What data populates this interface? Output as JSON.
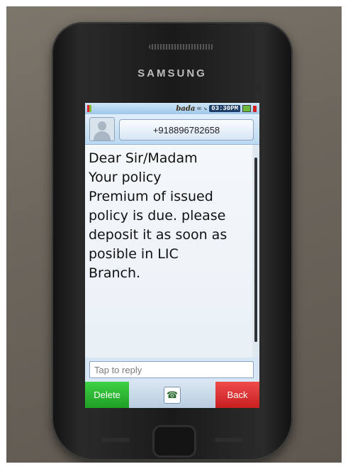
{
  "device": {
    "brand": "SAMSUNG"
  },
  "statusbar": {
    "app": "bada",
    "time": "03:30PM"
  },
  "header": {
    "sender": "+918896782658"
  },
  "message": {
    "lines": [
      "Dear Sir/Madam",
      "Your policy",
      "Premium of issued",
      "policy is due. please",
      "deposit it as soon as",
      "posible in LIC",
      "Branch."
    ]
  },
  "reply": {
    "placeholder": "Tap to reply"
  },
  "softkeys": {
    "delete_label": "Delete",
    "back_label": "Back",
    "call_icon": "phone-call-icon"
  },
  "colors": {
    "delete": "#2fbf35",
    "back": "#e03434",
    "header": "#bcd8f1"
  }
}
